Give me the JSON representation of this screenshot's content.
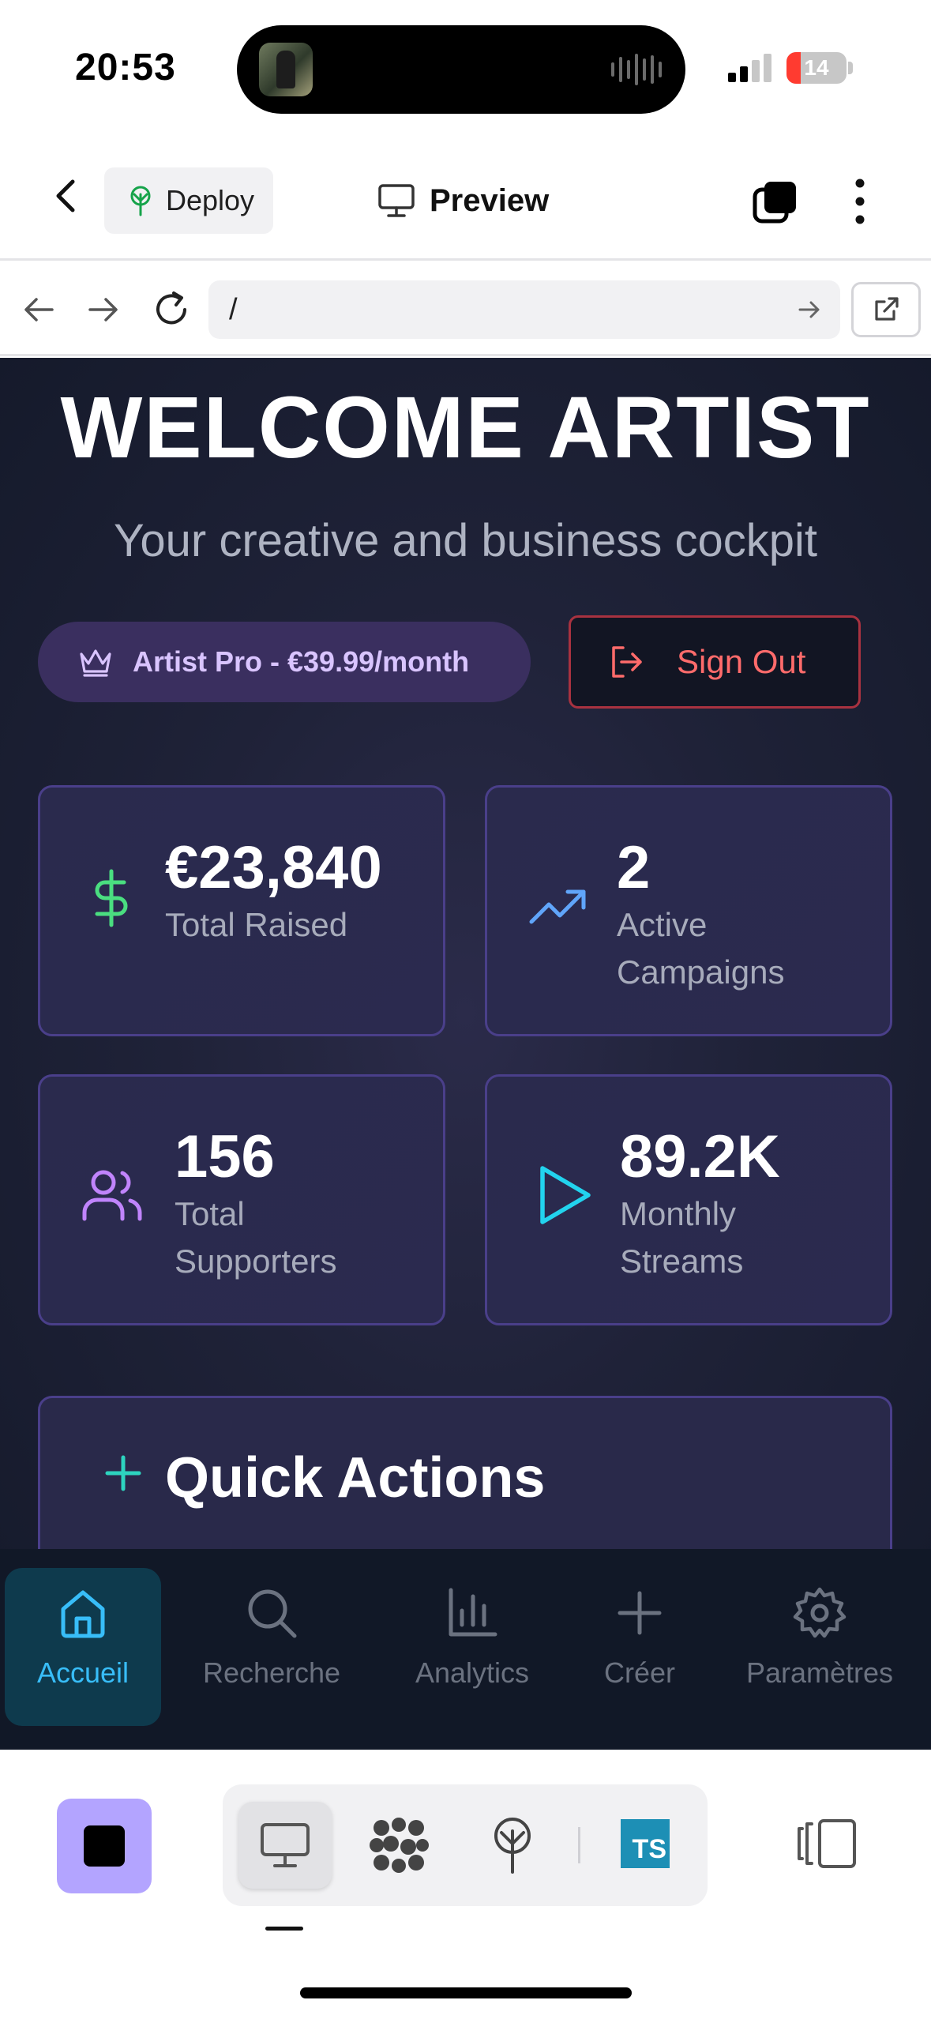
{
  "status_bar": {
    "time": "20:53",
    "battery": "14",
    "battery_color": "#ff3b30"
  },
  "topnav": {
    "back_icon": "chevron-left-icon",
    "deploy_label": "Deploy",
    "deploy_icon": "deploy-tree-icon",
    "preview_label": "Preview",
    "preview_icon": "monitor-icon",
    "layers_icon": "layers-icon",
    "more_icon": "more-vertical-icon"
  },
  "urlbar": {
    "back_icon": "arrow-left-icon",
    "forward_icon": "arrow-right-icon",
    "reload_icon": "reload-icon",
    "url": "/",
    "go_icon": "arrow-right-icon",
    "open_icon": "external-link-icon"
  },
  "app": {
    "title": "WELCOME ARTIST",
    "subtitle": "Your creative and business cockpit",
    "plan": "Artist Pro - €39.99/month",
    "sign_out": "Sign Out",
    "stats": [
      {
        "value": "€23,840",
        "label_lines": [
          "Total Raised"
        ],
        "icon": "dollar-icon",
        "color": "#4ade80"
      },
      {
        "value": "2",
        "label_lines": [
          "Active",
          "Campaigns"
        ],
        "icon": "trending-up-icon",
        "color": "#60a5fa"
      },
      {
        "value": "156",
        "label_lines": [
          "Total",
          "Supporters"
        ],
        "icon": "users-icon",
        "color": "#c084fc"
      },
      {
        "value": "89.2K",
        "label_lines": [
          "Monthly",
          "Streams"
        ],
        "icon": "play-icon",
        "color": "#22d3ee"
      }
    ],
    "quick_actions_title": "Quick Actions",
    "accent": "#2dd4bf"
  },
  "tabbar": {
    "tabs": [
      {
        "label": "Accueil",
        "icon": "home-icon",
        "active": true
      },
      {
        "label": "Recherche",
        "icon": "search-icon",
        "active": false
      },
      {
        "label": "Analytics",
        "icon": "bar-chart-icon",
        "active": false
      },
      {
        "label": "Créer",
        "icon": "plus-icon",
        "active": false
      },
      {
        "label": "Paramètres",
        "icon": "settings-icon",
        "active": false
      }
    ]
  },
  "toolbar": {
    "stop_icon": "stop-icon",
    "tools": [
      "monitor-icon",
      "packages-icon",
      "deploy-tree-icon"
    ],
    "ts_badge": "TS",
    "panel_icon": "panel-toggle-icon"
  }
}
